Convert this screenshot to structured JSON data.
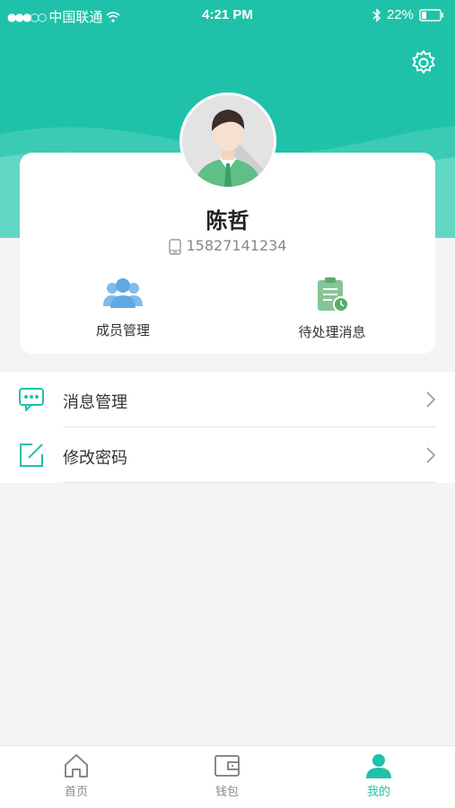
{
  "status_bar": {
    "carrier": "中国联通",
    "time": "4:21 PM",
    "battery": "22%"
  },
  "profile": {
    "name": "陈哲",
    "phone": "15827141234"
  },
  "quick_actions": [
    {
      "label": "成员管理",
      "icon": "people-icon"
    },
    {
      "label": "待处理消息",
      "icon": "clipboard-clock-icon"
    }
  ],
  "menu": [
    {
      "label": "消息管理",
      "icon": "chat-bubble-icon"
    },
    {
      "label": "修改密码",
      "icon": "edit-icon"
    }
  ],
  "tabs": [
    {
      "label": "首页",
      "icon": "home-icon",
      "active": false
    },
    {
      "label": "钱包",
      "icon": "wallet-icon",
      "active": false
    },
    {
      "label": "我的",
      "icon": "user-icon",
      "active": true
    }
  ],
  "colors": {
    "accent": "#1fc2a9",
    "background": "#f4f4f4"
  }
}
